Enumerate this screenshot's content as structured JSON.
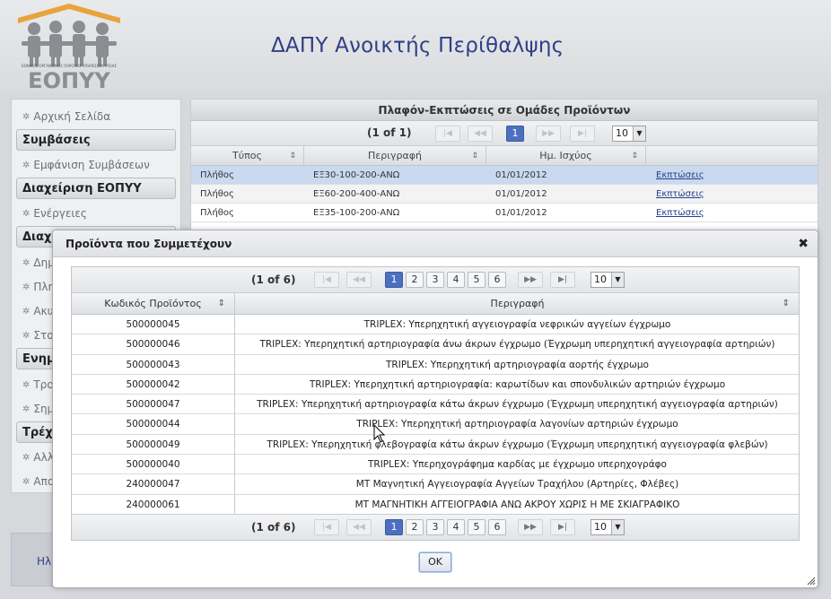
{
  "header": {
    "logo_text": "ΕΟΠΥΥ",
    "logo_subtext": "ΕΘΝΙΚΟΣ ΟΡΓΑΝΙΣΜΟΣ ΠΑΡΟΧΗΣ ΥΠΗΡΕΣΙΩΝ ΥΓΕΙΑΣ",
    "title": "ΔΑΠΥ Ανοικτής Περίθαλψης"
  },
  "sidebar": {
    "items": [
      {
        "type": "link",
        "label": "Αρχική Σελίδα"
      },
      {
        "type": "header",
        "label": "Συμβάσεις"
      },
      {
        "type": "link",
        "label": "Εμφάνιση Συμβάσεων"
      },
      {
        "type": "header",
        "label": "Διαχείριση ΕΟΠΥΥ"
      },
      {
        "type": "link",
        "label": "Ενέργειες"
      },
      {
        "type": "header",
        "label": "Διαχ"
      },
      {
        "type": "link",
        "label": "Δημ"
      },
      {
        "type": "link",
        "label": "Πλη"
      },
      {
        "type": "link",
        "label": "Ακυ"
      },
      {
        "type": "link",
        "label": "Στο"
      },
      {
        "type": "header",
        "label": "Ενημ"
      },
      {
        "type": "link",
        "label": "Τρο"
      },
      {
        "type": "link",
        "label": "Σημ"
      },
      {
        "type": "header",
        "label": "Τρέχ"
      },
      {
        "type": "link",
        "label": "Αλλ"
      },
      {
        "type": "link",
        "label": "Απο"
      }
    ],
    "footer_text": "Ηλ"
  },
  "main_panel": {
    "title": "Πλαφόν-Εκπτώσεις σε Ομάδες Προϊόντων",
    "pager": {
      "count": "(1 of 1)",
      "page": "1",
      "rows_per_page": "10"
    },
    "columns": [
      "Τύπος",
      "Περιγραφή",
      "Ημ. Ισχύος",
      ""
    ],
    "rows": [
      {
        "type": "Πλήθος",
        "desc": "ΕΞ30-100-200-ΑΝΩ",
        "date": "01/01/2012",
        "link": "Εκπτώσεις"
      },
      {
        "type": "Πλήθος",
        "desc": "ΕΞ60-200-400-ΑΝΩ",
        "date": "01/01/2012",
        "link": "Εκπτώσεις"
      },
      {
        "type": "Πλήθος",
        "desc": "ΕΞ35-100-200-ΑΝΩ",
        "date": "01/01/2012",
        "link": "Εκπτώσεις"
      }
    ]
  },
  "dialog": {
    "title": "Προϊόντα που Συμμετέχουν",
    "close_symbol": "✖",
    "pager": {
      "count": "(1 of 6)",
      "pages": [
        "1",
        "2",
        "3",
        "4",
        "5",
        "6"
      ],
      "active_page": "1",
      "rows_per_page": "10"
    },
    "columns": [
      "Κωδικός Προϊόντος",
      "Περιγραφή"
    ],
    "rows": [
      {
        "code": "500000045",
        "desc": "TRIPLEX: Υπερηχητική αγγειογραφία νεφρικών αγγείων έγχρωμο"
      },
      {
        "code": "500000046",
        "desc": "TRIPLEX: Υπερηχητική αρτηριογραφία άνω άκρων έγχρωμο (Έγχρωμη υπερηχητική αγγειογραφία αρτηριών)"
      },
      {
        "code": "500000043",
        "desc": "TRIPLEX: Υπερηχητική αρτηριογραφία αορτής έγχρωμο"
      },
      {
        "code": "500000042",
        "desc": "TRIPLEX: Υπερηχητική αρτηριογραφία: καρωτίδων και σπονδυλικών αρτηριών έγχρωμο"
      },
      {
        "code": "500000047",
        "desc": "TRIPLEX: Υπερηχητική αρτηριογραφία κάτω άκρων έγχρωμο (Έγχρωμη υπερηχητική αγγειογραφία αρτηριών)"
      },
      {
        "code": "500000044",
        "desc": "TRIPLEX: Υπερηχητική αρτηριογραφία λαγονίων αρτηριών έγχρωμο"
      },
      {
        "code": "500000049",
        "desc": "TRIPLEX: Υπερηχητική φλεβογραφία κάτω άκρων έγχρωμο (Έγχρωμη υπερηχητική αγγειογραφία φλεβών)"
      },
      {
        "code": "500000040",
        "desc": "TRIPLEX: Υπερηχογράφημα καρδίας με έγχρωμο υπερηχογράφο"
      },
      {
        "code": "240000047",
        "desc": "ΜΤ Μαγνητική Αγγειογραφία Αγγείων Τραχήλου (Αρτηρίες, Φλέβες)"
      },
      {
        "code": "240000061",
        "desc": "ΜΤ ΜΑΓΝΗΤΙΚΗ ΑΓΓΕΙΟΓΡΑΦΙΑ ΑΝΩ ΑΚΡΟΥ ΧΩΡΙΣ Η ΜΕ ΣΚΙΑΓΡΑΦΙΚΟ"
      }
    ],
    "ok_label": "OK"
  },
  "colors": {
    "title_blue": "#2f3f86",
    "active_page": "#4c6fc2",
    "selected_row": "#c9d9ef",
    "logo_orange": "#e8a33c",
    "logo_gray": "#8a8d91"
  }
}
